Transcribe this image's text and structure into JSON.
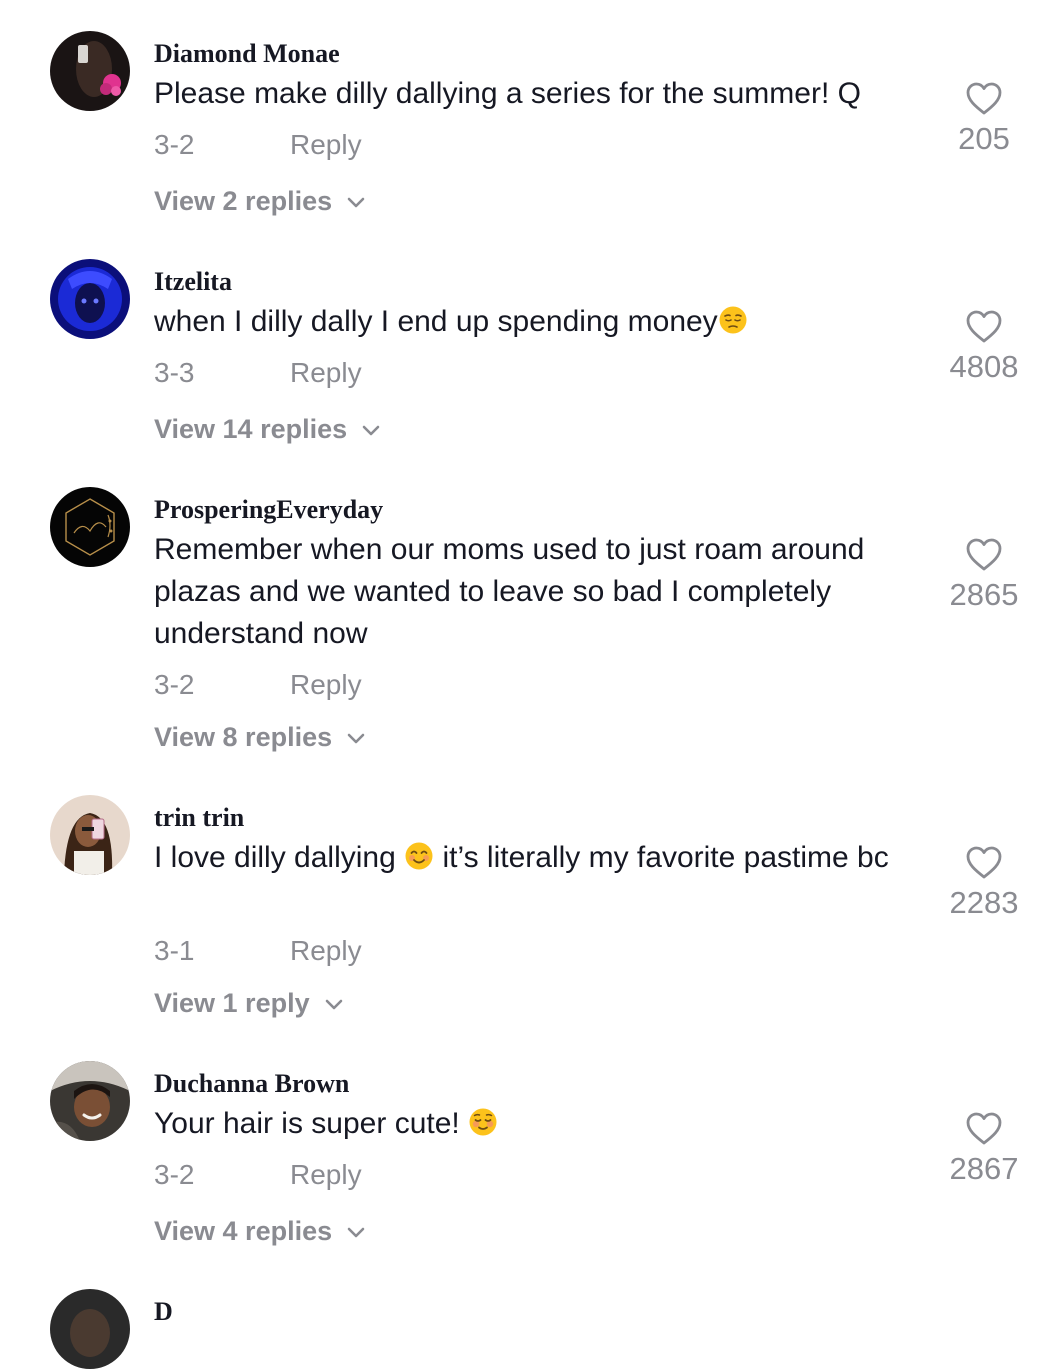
{
  "comments": [
    {
      "username": "Diamond Monae",
      "text": "Please make dilly dallying a series for the summer! Q",
      "date": "3-2",
      "reply_label": "Reply",
      "view_replies": "View 2 replies",
      "likes": "205"
    },
    {
      "username": "Itzelita",
      "text": "when I dilly dally I end up spending money",
      "emoji": "pensive-face-emoji",
      "date": "3-3",
      "reply_label": "Reply",
      "view_replies": "View 14 replies",
      "likes": "4808"
    },
    {
      "username": "ProsperingEveryday",
      "text": "Remember when our moms used to just roam around plazas and we wanted to leave so bad I completely understand now",
      "date": "3-2",
      "reply_label": "Reply",
      "view_replies": "View 8 replies",
      "likes": "2865"
    },
    {
      "username": "trin trin",
      "text_before": "I love dilly dallying ",
      "emoji": "smiling-face-emoji",
      "text_after": " it’s literally my favorite pastime bc",
      "date": "3-1",
      "reply_label": "Reply",
      "view_replies": "View 1 reply",
      "likes": "2283"
    },
    {
      "username": "Duchanna Brown",
      "text": "Your hair is super cute! ",
      "emoji": "relieved-smiling-face-emoji",
      "date": "3-2",
      "reply_label": "Reply",
      "view_replies": "View 4 replies",
      "likes": "2867"
    },
    {
      "username": "D"
    }
  ],
  "colors": {
    "text_primary": "#161823",
    "text_secondary": "#8a8b91",
    "background": "#ffffff"
  }
}
